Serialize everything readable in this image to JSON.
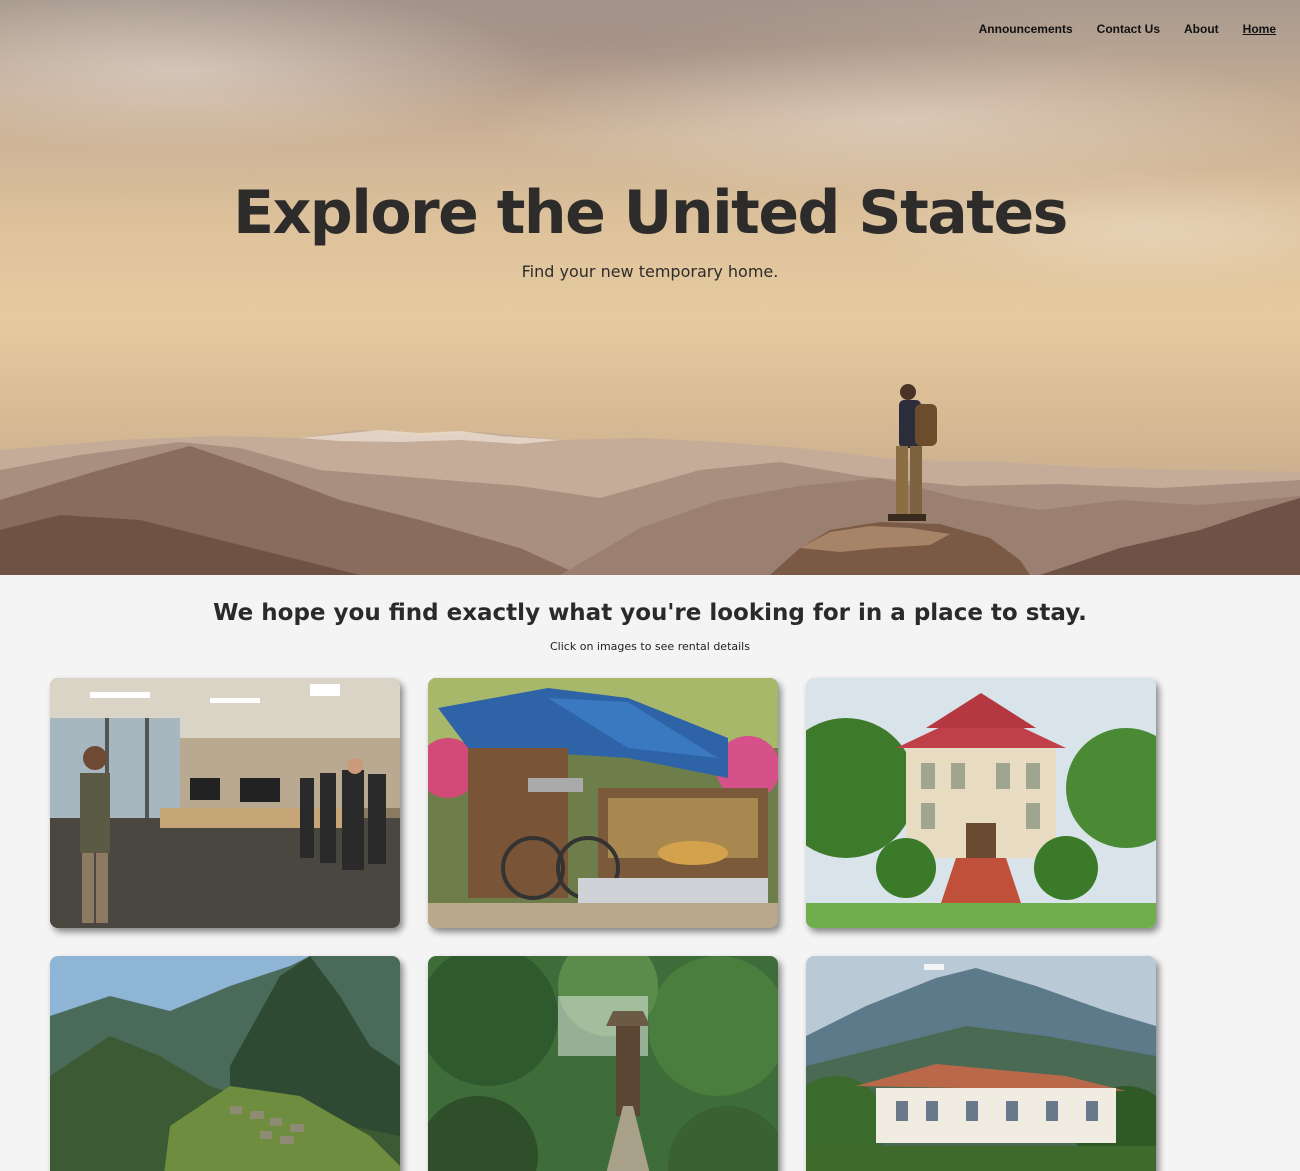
{
  "nav": {
    "items": [
      {
        "label": "Announcements",
        "active": false
      },
      {
        "label": "Contact Us",
        "active": false
      },
      {
        "label": "About",
        "active": false
      },
      {
        "label": "Home",
        "active": true
      }
    ]
  },
  "hero": {
    "title": "Explore the United States",
    "subtitle": "Find your new temporary home."
  },
  "intro": {
    "heading": "We hope you find exactly what you're looking for in a place to stay.",
    "note": "Click on images to see rental details"
  },
  "colors": {
    "hero_sky": "#dcc19b",
    "page_background": "#f4f4f4",
    "text": "#2e2c2b"
  }
}
